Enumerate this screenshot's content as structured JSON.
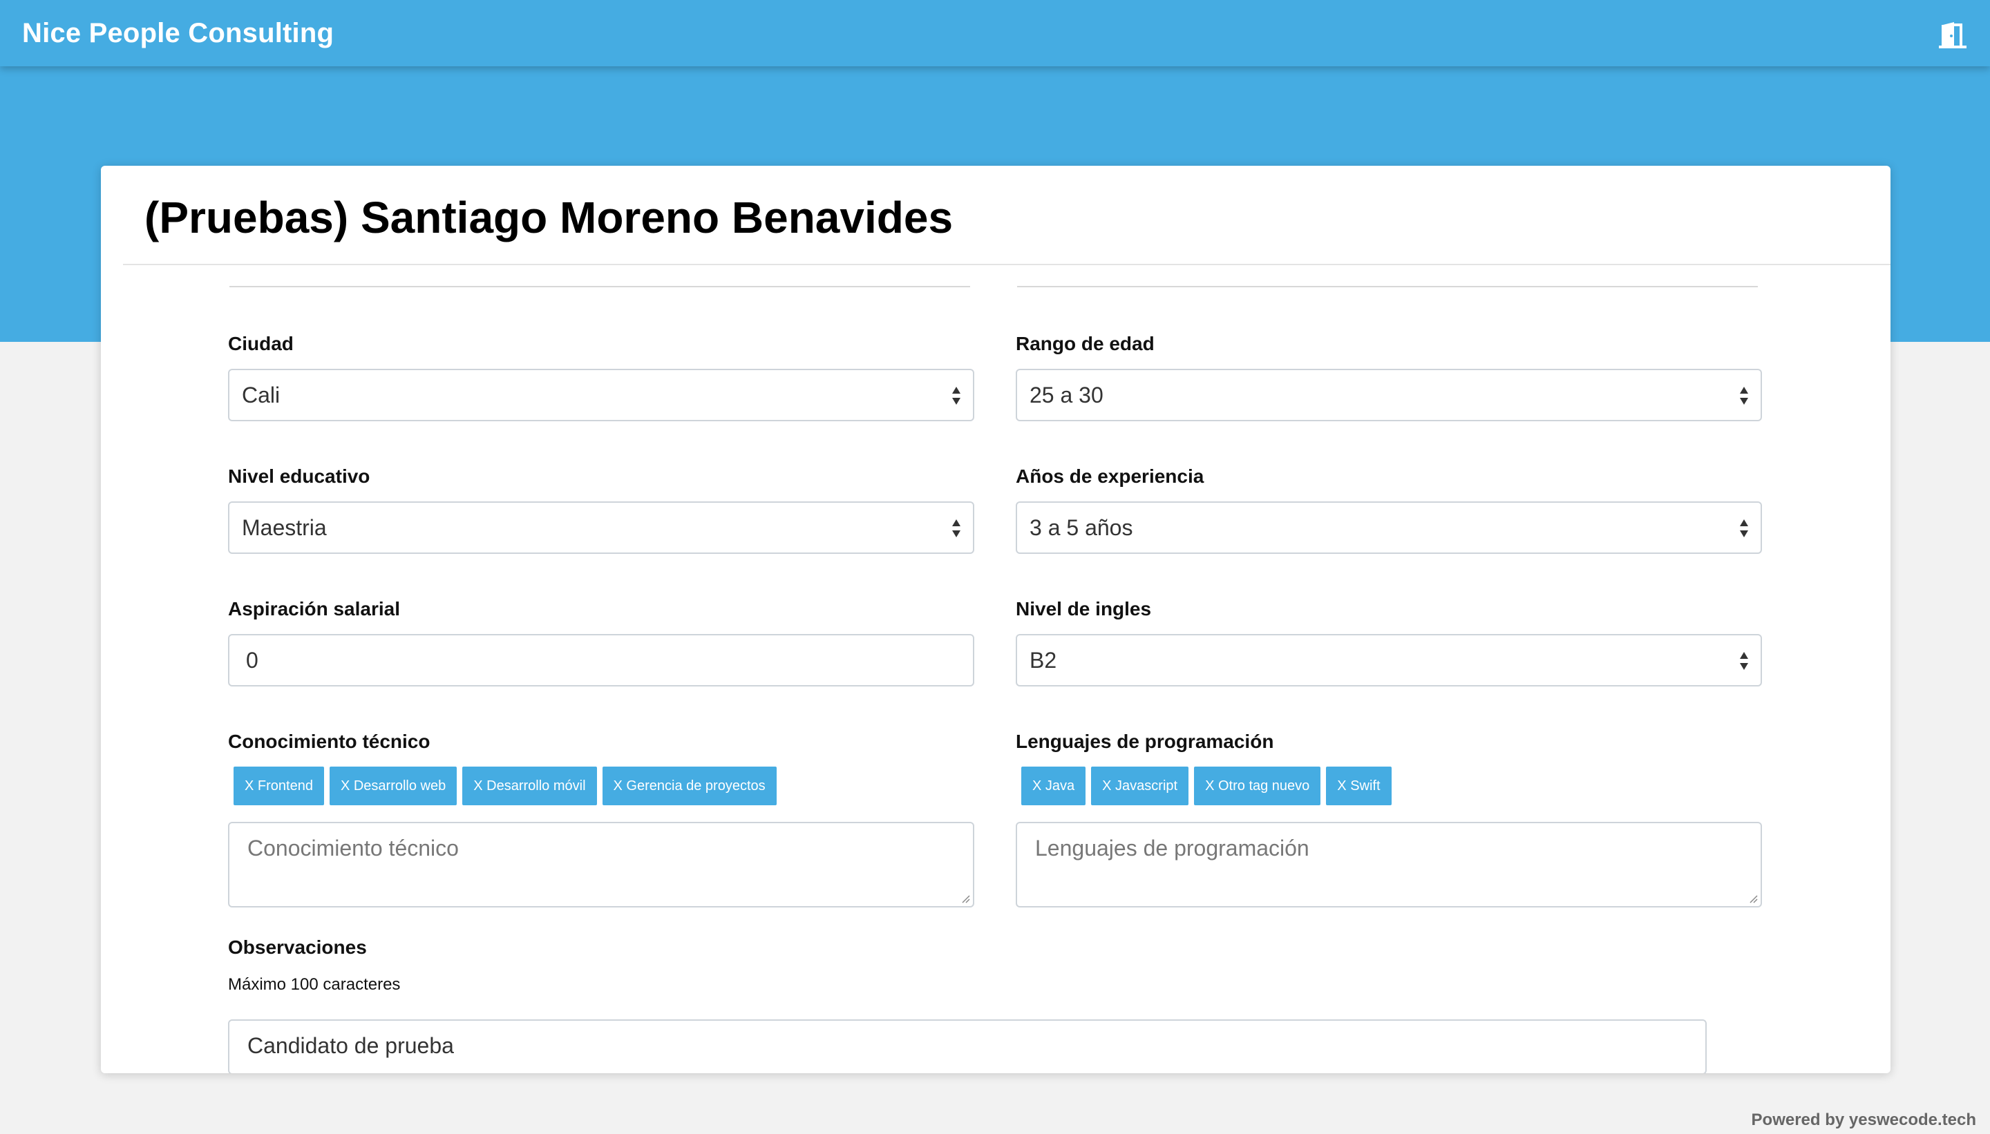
{
  "app": {
    "brand": "Nice People Consulting"
  },
  "candidate": {
    "title": "(Pruebas) Santiago Moreno Benavides"
  },
  "fields": {
    "ciudad": {
      "label": "Ciudad",
      "value": "Cali"
    },
    "rango_edad": {
      "label": "Rango de edad",
      "value": "25 a 30"
    },
    "nivel_educativo": {
      "label": "Nivel educativo",
      "value": "Maestria"
    },
    "anos_experiencia": {
      "label": "Años de experiencia",
      "value": "3 a 5 años"
    },
    "aspiracion_salarial": {
      "label": "Aspiración salarial",
      "value": "0"
    },
    "nivel_ingles": {
      "label": "Nivel de ingles",
      "value": "B2"
    },
    "conocimiento_tecnico": {
      "label": "Conocimiento técnico",
      "placeholder": "Conocimiento técnico",
      "tags": [
        "X Frontend",
        "X Desarrollo web",
        "X Desarrollo móvil",
        "X Gerencia de proyectos"
      ]
    },
    "lenguajes": {
      "label": "Lenguajes de programación",
      "placeholder": "Lenguajes de programación",
      "tags": [
        "X Java",
        "X Javascript",
        "X Otro tag nuevo",
        "X Swift"
      ]
    },
    "observaciones": {
      "label": "Observaciones",
      "hint": "Máximo 100 caracteres",
      "value": "Candidato de prueba"
    }
  },
  "footer": {
    "text": "Powered by yeswecode.tech"
  },
  "colors": {
    "accent": "#45ace2",
    "background": "#f2f2f2"
  },
  "icons": {
    "exit": "exit-door-icon"
  }
}
